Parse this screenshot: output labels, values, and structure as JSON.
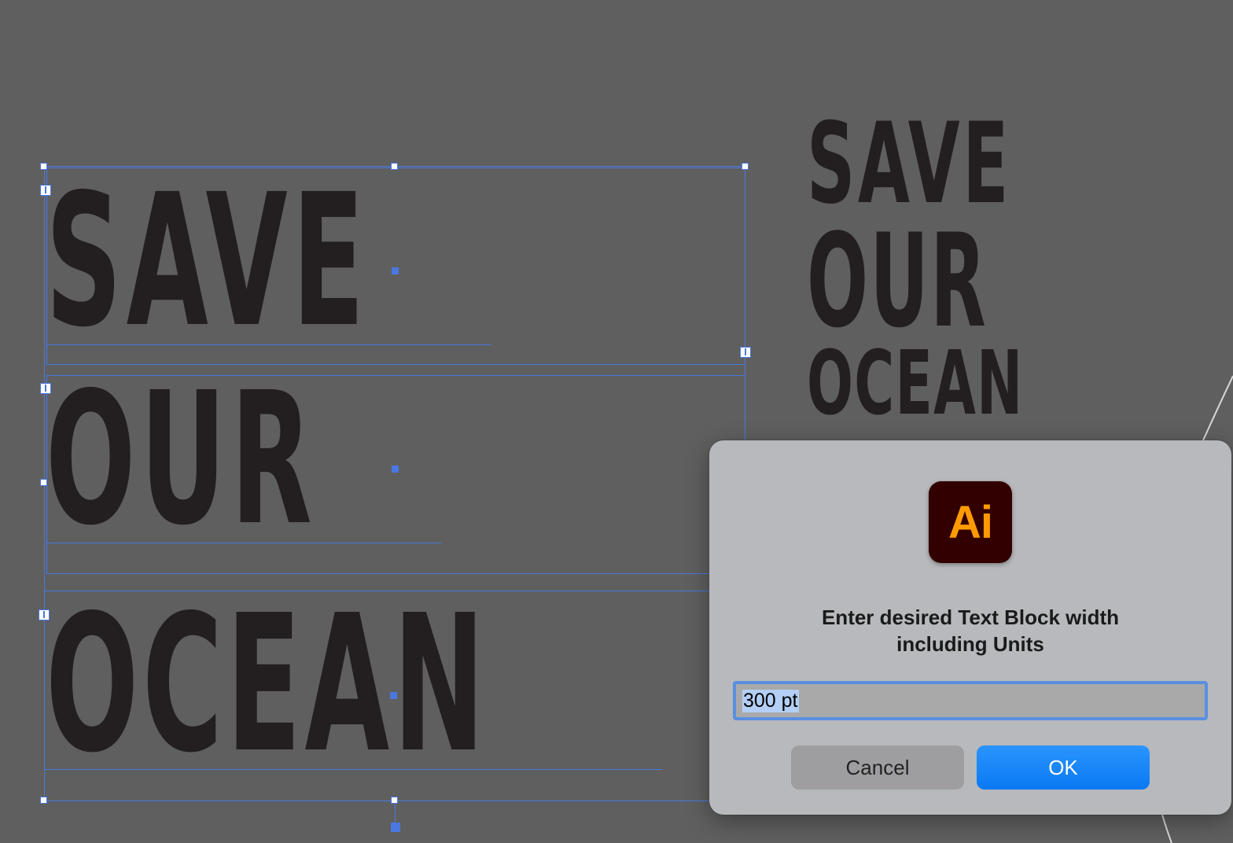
{
  "artwork": {
    "main_text": {
      "line1": "SAVE",
      "line2": "OUR",
      "line3": "OCEAN"
    },
    "preview_text": {
      "line1": "SAVE",
      "line2": "OUR",
      "line3": "OCEAN"
    },
    "text_color": "#231f20",
    "selection_color": "#4a78e0",
    "canvas_color": "#5f5f5f"
  },
  "dialog": {
    "app_icon": {
      "name": "adobe-illustrator-icon",
      "label": "Ai",
      "bg_color": "#330000",
      "fg_color": "#ff9a00"
    },
    "message_line1": "Enter desired Text Block width",
    "message_line2": "including Units",
    "input": {
      "value": "300 pt"
    },
    "buttons": {
      "cancel_label": "Cancel",
      "ok_label": "OK"
    },
    "accent_color": "#0a7af5"
  }
}
